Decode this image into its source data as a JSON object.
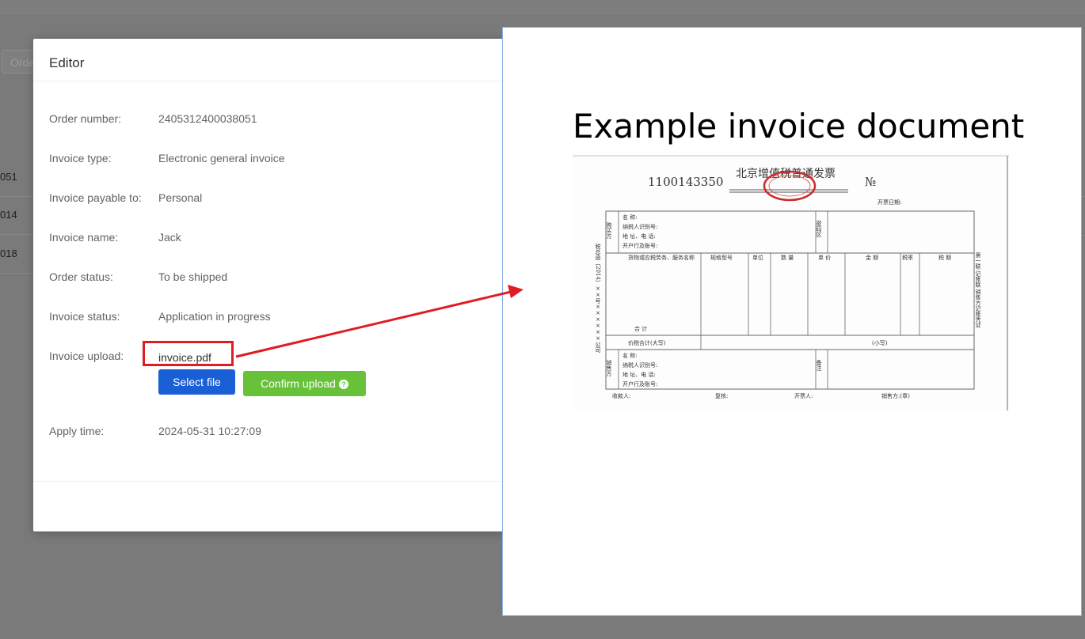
{
  "background": {
    "search_placeholder": "Orde",
    "rows": [
      "051",
      "014",
      "018"
    ]
  },
  "modal": {
    "title": "Editor",
    "fields": [
      {
        "label": "Order number:",
        "value": "2405312400038051"
      },
      {
        "label": "Invoice type:",
        "value": "Electronic general invoice"
      },
      {
        "label": "Invoice payable to:",
        "value": "Personal"
      },
      {
        "label": "Invoice name:",
        "value": "Jack"
      },
      {
        "label": "Order status:",
        "value": "To be shipped"
      },
      {
        "label": "Invoice status:",
        "value": "Application in progress"
      }
    ],
    "upload": {
      "label": "Invoice upload:",
      "filename": "invoice.pdf",
      "select_button": "Select file",
      "confirm_button": "Confirm upload",
      "confirm_icon": "question-circle-icon"
    },
    "apply_time": {
      "label": "Apply time:",
      "value": "2024-05-31 10:27:09"
    }
  },
  "example": {
    "title": "Example invoice document",
    "invoice": {
      "code": "1100143350",
      "header": "北京增值税普通发票",
      "no_mark": "№",
      "issue_date_label": "开票日期:",
      "buyer_side": "购买方",
      "buyer_lines": [
        "名 称:",
        "纳税人识别号:",
        "地 址、电 话:",
        "开户行及账号:"
      ],
      "password_area": "密码区",
      "columns": [
        "货物或应税劳务、服务名称",
        "规格型号",
        "单位",
        "数 量",
        "单 价",
        "金 额",
        "税率",
        "税 额"
      ],
      "total_label": "合 计",
      "grand_total_label": "价税合计(大写)",
      "lowercase_label": "(小写)",
      "seller_side": "销售方",
      "seller_lines": [
        "名 称:",
        "纳税人识别号:",
        "地 址、电 话:",
        "开户行及账号:"
      ],
      "remarks": "备注",
      "footer": [
        "收款人:",
        "复核:",
        "开票人:",
        "销售方:(章)"
      ],
      "left_margin_text": "税总函〔2014〕××号××××××公司",
      "right_margin_text": "第一联:记账联 销售方记账凭证"
    }
  },
  "colors": {
    "highlight": "#e01b23",
    "select_button": "#1a5fd6",
    "confirm_button": "#67c23a"
  }
}
